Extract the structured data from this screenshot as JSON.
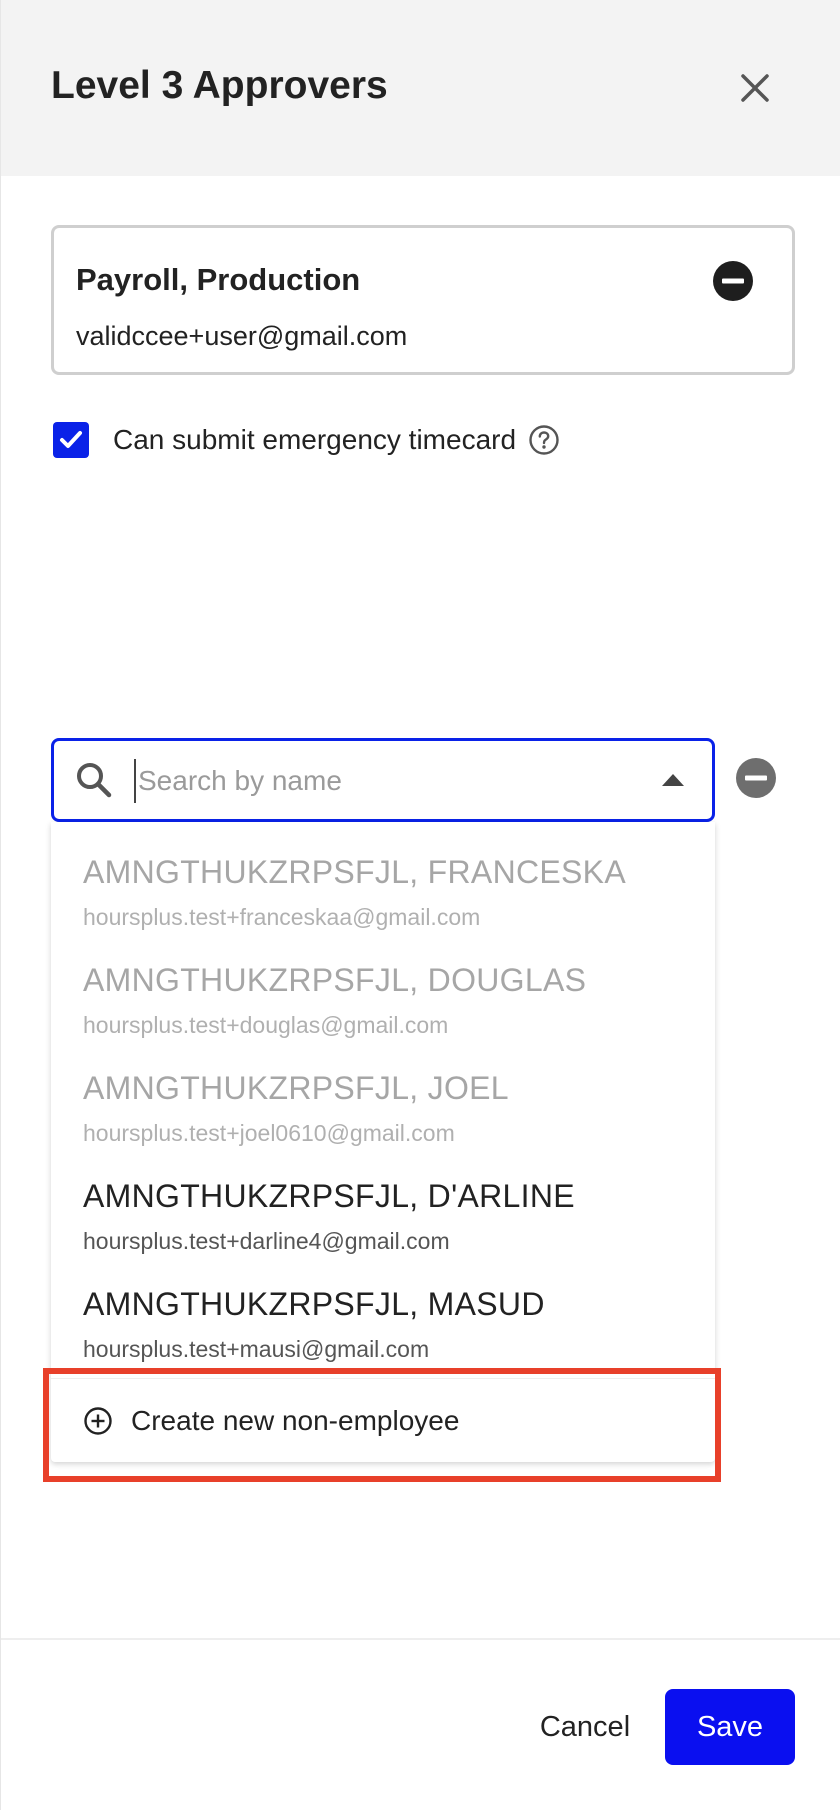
{
  "header": {
    "title": "Level 3 Approvers"
  },
  "approver": {
    "name": "Payroll, Production",
    "email": "validccee+user@gmail.com"
  },
  "emergency": {
    "label": "Can submit emergency timecard",
    "checked": true
  },
  "search": {
    "placeholder": "Search by name",
    "value": ""
  },
  "dropdown": {
    "options": [
      {
        "name": "AMNGTHUKZRPSFJL, FRANCESKA",
        "email": "hoursplus.test+franceskaa@gmail.com",
        "disabled": true
      },
      {
        "name": "AMNGTHUKZRPSFJL, DOUGLAS",
        "email": "hoursplus.test+douglas@gmail.com",
        "disabled": true
      },
      {
        "name": "AMNGTHUKZRPSFJL, JOEL",
        "email": "hoursplus.test+joel0610@gmail.com",
        "disabled": true
      },
      {
        "name": "AMNGTHUKZRPSFJL, D'ARLINE",
        "email": "hoursplus.test+darline4@gmail.com",
        "disabled": false
      },
      {
        "name": "AMNGTHUKZRPSFJL, MASUD",
        "email": "hoursplus.test+mausi@gmail.com",
        "disabled": false
      }
    ],
    "create_label": "Create new non-employee"
  },
  "footer": {
    "cancel_label": "Cancel",
    "save_label": "Save"
  },
  "colors": {
    "accent": "#0a22e8",
    "save": "#0a0ff0",
    "highlight": "#e8402a",
    "header_bg": "#f3f3f3"
  }
}
